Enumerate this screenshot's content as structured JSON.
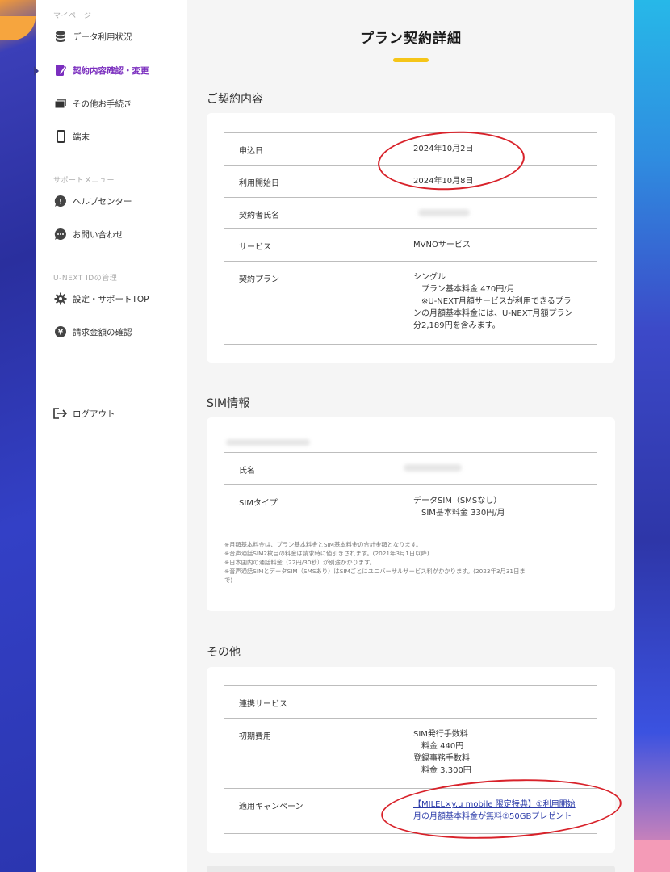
{
  "sidebar": {
    "section_mypage": "マイページ",
    "items": [
      {
        "label": "データ利用状況",
        "icon": "database-icon"
      },
      {
        "label": "契約内容確認・変更",
        "icon": "contract-edit-icon"
      },
      {
        "label": "その他お手続き",
        "icon": "cards-icon"
      },
      {
        "label": "端末",
        "icon": "smartphone-icon"
      }
    ],
    "section_support": "サポートメニュー",
    "support_items": [
      {
        "label": "ヘルプセンター",
        "icon": "help-icon"
      },
      {
        "label": "お問い合わせ",
        "icon": "chat-icon"
      }
    ],
    "section_unext": "U-NEXT IDの管理",
    "unext_items": [
      {
        "label": "設定・サポートTOP",
        "icon": "gear-icon"
      },
      {
        "label": "請求金額の確認",
        "icon": "yen-icon"
      }
    ],
    "logout": "ログアウト"
  },
  "main": {
    "title": "プラン契約詳細",
    "contract": {
      "heading": "ご契約内容",
      "apply_date_label": "申込日",
      "apply_date": "2024年10月2日",
      "start_date_label": "利用開始日",
      "start_date": "2024年10月8日",
      "holder_label": "契約者氏名",
      "service_label": "サービス",
      "service": "MVNOサービス",
      "plan_label": "契約プラン",
      "plan": "シングル\n　プラン基本料金 470円/月\n　※U-NEXT月額サービスが利用できるプラ\nンの月額基本料金には、U-NEXT月額プラン\n分2,189円を含みます。"
    },
    "sim": {
      "heading": "SIM情報",
      "name_label": "氏名",
      "type_label": "SIMタイプ",
      "type": "データSIM（SMSなし）\n　SIM基本料金 330円/月",
      "notes": [
        "※月額基本料金は、プラン基本料金とSIM基本料金の合計金額となります。",
        "※音声通話SIM2枚目の料金は請求時に値引きされます。(2021年3月1日以降)",
        "※日本国内の通話料金（22円/30秒）が別途かかります。",
        "※音声通話SIMとデータSIM（SMSあり）はSIMごとにユニバーサルサービス料がかかります。(2023年3月31日ま",
        "で)"
      ]
    },
    "other": {
      "heading": "その他",
      "linked_label": "連携サービス",
      "initial_label": "初期費用",
      "initial": "SIM発行手数料\n　料金  440円\n登録事務手数料\n　料金  3,300円",
      "campaign_label": "適用キャンペーン",
      "campaign_link": "【MILEL×y.u mobile 限定特典】①利用開始\n月の月額基本料金が無料②50GBプレゼント"
    }
  }
}
